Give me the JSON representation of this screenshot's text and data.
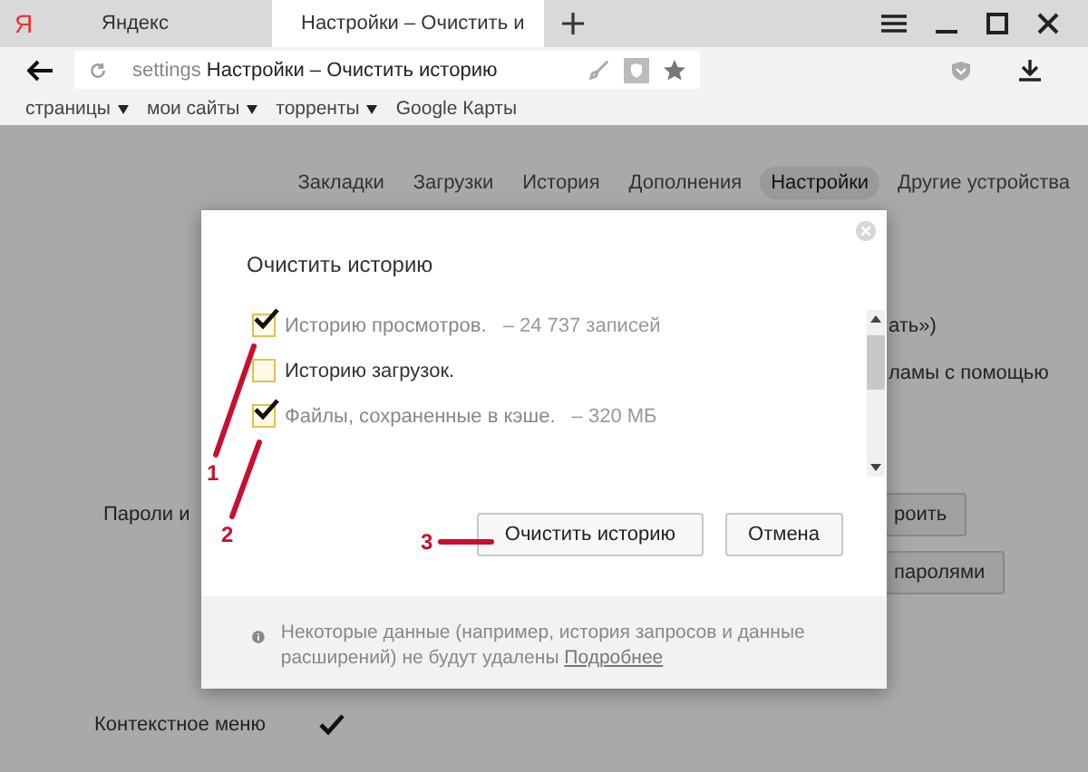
{
  "browser_tabs": [
    {
      "kind": "logo",
      "logo": "Я",
      "label": "Яндекс",
      "selected": false
    },
    {
      "kind": "page",
      "label": "Настройки – Очистить и",
      "selected": true
    }
  ],
  "address_bar": {
    "prefix": "settings",
    "value": "Настройки – Очистить историю"
  },
  "bookmarks": [
    {
      "label": "страницы",
      "dropdown": true
    },
    {
      "label": "мои сайты",
      "dropdown": true
    },
    {
      "label": "торренты",
      "dropdown": true
    },
    {
      "label": "Google Карты",
      "dropdown": false
    }
  ],
  "settings_nav": [
    {
      "label": "Закладки",
      "selected": false
    },
    {
      "label": "Загрузки",
      "selected": false
    },
    {
      "label": "История",
      "selected": false
    },
    {
      "label": "Дополнения",
      "selected": false
    },
    {
      "label": "Настройки",
      "selected": true
    },
    {
      "label": "Другие устройства",
      "selected": false
    }
  ],
  "background": {
    "text_1": "ать»)",
    "text_2": "ламы с помощью",
    "passwords_label": "Пароли и",
    "button_1": "роить",
    "button_2": "паролями",
    "context_menu_label": "Контекстное меню",
    "context_menu_checked": true
  },
  "dialog": {
    "title": "Очистить историю",
    "items": [
      {
        "label": "Историю просмотров.",
        "detail": "–  24 737 записей",
        "checked": true
      },
      {
        "label": "Историю загрузок.",
        "checked": false
      },
      {
        "label": "Файлы, сохраненные в кэше.",
        "detail": "–  320 МБ",
        "checked": true
      }
    ],
    "buttons": [
      {
        "label": "Очистить историю",
        "kind": "confirm"
      },
      {
        "label": "Отмена",
        "kind": "cancel"
      }
    ],
    "footer": {
      "text": "Некоторые данные (например, история запросов и данные расширений) не будут удалены",
      "link": "Подробнее"
    }
  },
  "annotations": [
    {
      "label": "1"
    },
    {
      "label": "2"
    },
    {
      "label": "3"
    }
  ]
}
